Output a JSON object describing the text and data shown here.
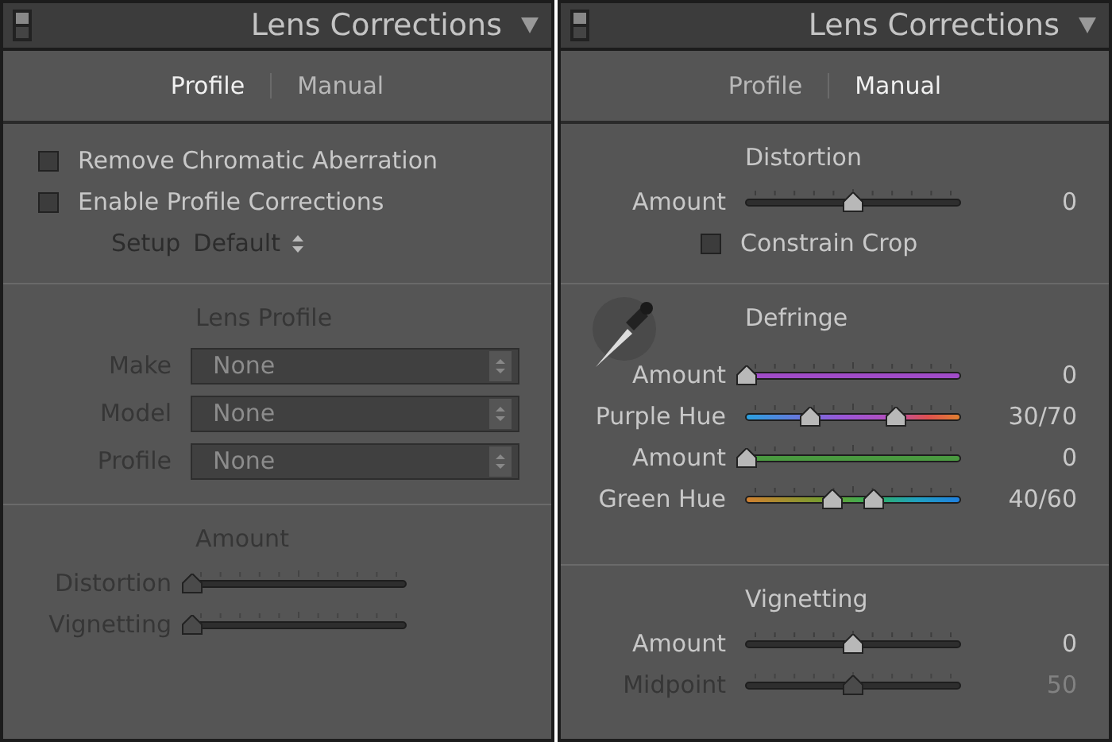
{
  "panels": [
    {
      "title": "Lens Corrections",
      "tabs": [
        {
          "label": "Profile",
          "selected": true
        },
        {
          "label": "Manual",
          "selected": false
        }
      ],
      "sections": [
        {
          "items": [
            {
              "kind": "checkbox",
              "label": "Remove Chromatic Aberration",
              "checked": false
            },
            {
              "kind": "checkbox",
              "label": "Enable Profile Corrections",
              "checked": false
            },
            {
              "kind": "stepper",
              "label": "Setup",
              "value": "Default"
            }
          ]
        },
        {
          "heading": "Lens Profile",
          "disabled": true,
          "items": [
            {
              "kind": "dropdown",
              "label": "Make",
              "value": "None"
            },
            {
              "kind": "dropdown",
              "label": "Model",
              "value": "None"
            },
            {
              "kind": "dropdown",
              "label": "Profile",
              "value": "None"
            }
          ]
        },
        {
          "heading": "Amount",
          "disabled": true,
          "items": [
            {
              "kind": "slider",
              "label": "Distortion",
              "track": {
                "kind": "plain"
              },
              "thumbs": [
                {
                  "level": 0
                }
              ]
            },
            {
              "kind": "slider",
              "label": "Vignetting",
              "track": {
                "kind": "plain"
              },
              "thumbs": [
                {
                  "level": 0
                }
              ]
            }
          ]
        }
      ]
    },
    {
      "title": "Lens Corrections",
      "tabs": [
        {
          "label": "Profile",
          "selected": false
        },
        {
          "label": "Manual",
          "selected": true
        }
      ],
      "sections": [
        {
          "heading": "Distortion",
          "items": [
            {
              "kind": "slider",
              "label": "Amount",
              "track": {
                "kind": "plain"
              },
              "thumbs": [
                {
                  "level": 0.5
                }
              ],
              "value": "0"
            },
            {
              "kind": "checkbox",
              "label": "Constrain Crop",
              "checked": false
            }
          ]
        },
        {
          "heading": "Defringe",
          "eyedropper": true,
          "items": [
            {
              "kind": "slider",
              "label": "Amount",
              "track": {
                "kind": "purple"
              },
              "thumbs": [
                {
                  "level": 0
                }
              ],
              "value": "0"
            },
            {
              "kind": "slider",
              "label": "Purple Hue",
              "track": {
                "kind": "purple_hue"
              },
              "thumbs": [
                {
                  "level": 0.3
                },
                {
                  "level": 0.7
                }
              ],
              "value": "30/70"
            },
            {
              "kind": "slider",
              "label": "Amount",
              "track": {
                "kind": "green"
              },
              "thumbs": [
                {
                  "level": 0
                }
              ],
              "value": "0"
            },
            {
              "kind": "slider",
              "label": "Green Hue",
              "track": {
                "kind": "green_hue"
              },
              "thumbs": [
                {
                  "level": 0.4
                },
                {
                  "level": 0.6
                }
              ],
              "value": "40/60"
            }
          ]
        },
        {
          "heading": "Vignetting",
          "items": [
            {
              "kind": "slider",
              "label": "Amount",
              "track": {
                "kind": "plain"
              },
              "thumbs": [
                {
                  "level": 0.5
                }
              ],
              "value": "0"
            },
            {
              "kind": "slider",
              "label": "Midpoint",
              "track": {
                "kind": "plain"
              },
              "thumbs": [
                {
                  "level": 0.5
                }
              ],
              "value": "50",
              "disabled": true
            }
          ]
        }
      ]
    }
  ]
}
